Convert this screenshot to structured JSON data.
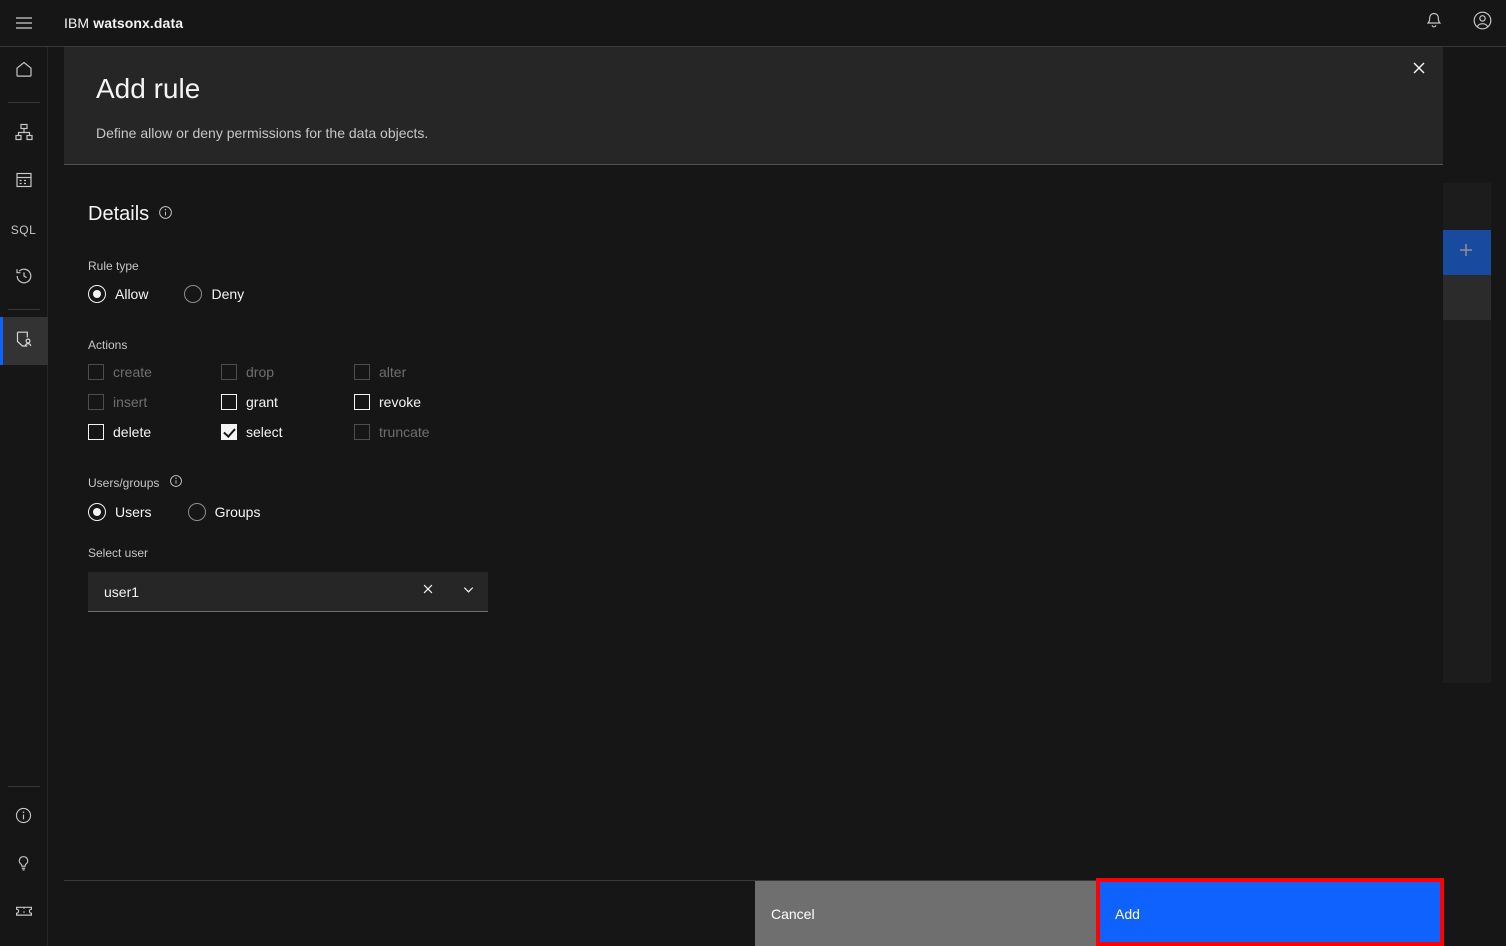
{
  "header": {
    "menu_icon": "hamburger-icon",
    "brand_prefix": "IBM",
    "brand_name": "watsonx.data",
    "notifications_icon": "bell-icon",
    "account_icon": "user-avatar-icon"
  },
  "sidebar": {
    "items": [
      {
        "name": "home",
        "icon": "home-icon",
        "active": false
      },
      {
        "name": "infrastructure",
        "icon": "infrastructure-icon",
        "active": false
      },
      {
        "name": "data-manager",
        "icon": "data-table-icon",
        "active": false
      },
      {
        "name": "sql",
        "icon": "sql-icon",
        "active": false
      },
      {
        "name": "query-history",
        "icon": "history-icon",
        "active": false
      },
      {
        "name": "access-control",
        "icon": "access-control-icon",
        "active": true
      }
    ],
    "bottom_items": [
      {
        "name": "about",
        "icon": "info-icon"
      },
      {
        "name": "tips",
        "icon": "lightbulb-icon"
      },
      {
        "name": "support",
        "icon": "ticket-icon"
      }
    ]
  },
  "background": {
    "add_button_icon": "plus-icon"
  },
  "modal": {
    "title": "Add rule",
    "subtitle": "Define allow or deny permissions for the data objects.",
    "close_icon": "close-icon",
    "details": {
      "heading": "Details",
      "info_icon": "info-icon"
    },
    "rule_type": {
      "label": "Rule type",
      "options": [
        {
          "label": "Allow",
          "selected": true
        },
        {
          "label": "Deny",
          "selected": false
        }
      ]
    },
    "actions": {
      "label": "Actions",
      "items": [
        {
          "label": "create",
          "checked": false,
          "disabled": true
        },
        {
          "label": "drop",
          "checked": false,
          "disabled": true
        },
        {
          "label": "alter",
          "checked": false,
          "disabled": true
        },
        {
          "label": "insert",
          "checked": false,
          "disabled": true
        },
        {
          "label": "grant",
          "checked": false,
          "disabled": false
        },
        {
          "label": "revoke",
          "checked": false,
          "disabled": false
        },
        {
          "label": "delete",
          "checked": false,
          "disabled": false
        },
        {
          "label": "select",
          "checked": true,
          "disabled": false
        },
        {
          "label": "truncate",
          "checked": false,
          "disabled": true
        }
      ]
    },
    "users_groups": {
      "label": "Users/groups",
      "info_icon": "info-icon",
      "options": [
        {
          "label": "Users",
          "selected": true
        },
        {
          "label": "Groups",
          "selected": false
        }
      ]
    },
    "select_user": {
      "label": "Select user",
      "value": "user1",
      "placeholder": "Select user",
      "clear_icon": "close-icon",
      "expand_icon": "chevron-down-icon"
    },
    "footer": {
      "cancel_label": "Cancel",
      "add_label": "Add"
    }
  },
  "colors": {
    "accent_blue": "#0f62fe",
    "highlight_red": "#ff0000",
    "cancel_gray": "#6f6f6f"
  }
}
